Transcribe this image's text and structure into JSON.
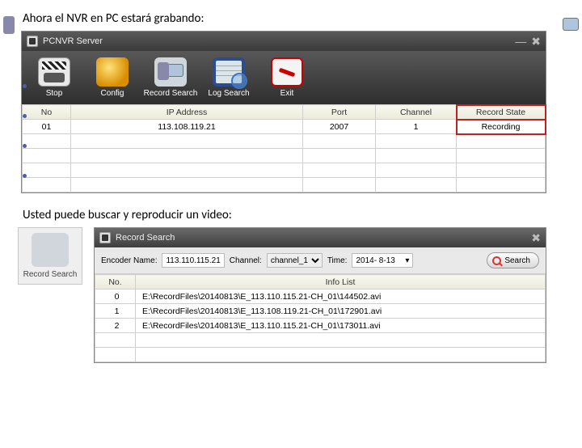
{
  "caption1": "Ahora el NVR en PC estará grabando:",
  "caption2": "Usted puede buscar y reproducir un video:",
  "win1": {
    "title": "PCNVR Server",
    "toolbar": {
      "stop": "Stop",
      "config": "Config",
      "record_search": "Record Search",
      "log_search": "Log Search",
      "exit": "Exit"
    },
    "table": {
      "headers": {
        "no": "No",
        "ip": "IP Address",
        "port": "Port",
        "channel": "Channel",
        "state": "Record State"
      },
      "row": {
        "no": "01",
        "ip": "113.108.119.21",
        "port": "2007",
        "channel": "1",
        "state": "Recording"
      }
    }
  },
  "mini": {
    "label": "Record Search"
  },
  "win2": {
    "title": "Record Search",
    "filter": {
      "encoder_label": "Encoder Name:",
      "encoder_value": "113.110.115.21",
      "channel_label": "Channel:",
      "channel_value": "channel_1",
      "time_label": "Time:",
      "time_value": "2014- 8-13",
      "search": "Search"
    },
    "table": {
      "headers": {
        "no": "No.",
        "info": "Info List"
      },
      "rows": [
        {
          "no": "0",
          "info": "E:\\RecordFiles\\20140813\\E_113.110.115.21-CH_01\\144502.avi"
        },
        {
          "no": "1",
          "info": "E:\\RecordFiles\\20140813\\E_113.108.119.21-CH_01\\172901.avi"
        },
        {
          "no": "2",
          "info": "E:\\RecordFiles\\20140813\\E_113.110.115.21-CH_01\\173011.avi"
        }
      ]
    }
  }
}
